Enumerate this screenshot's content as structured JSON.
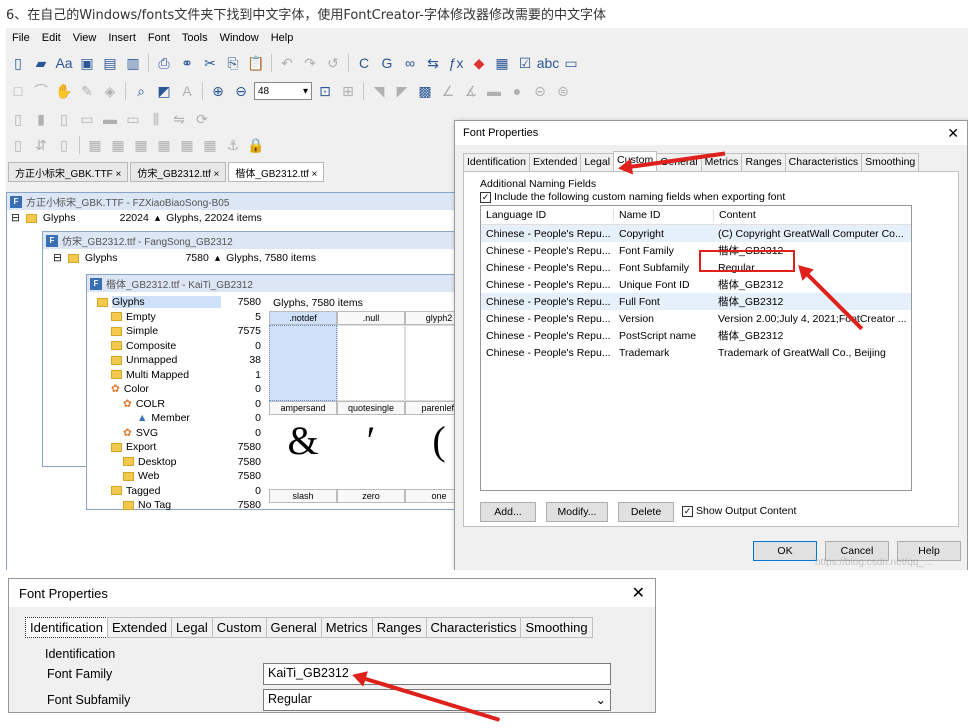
{
  "caption": "6、在自己的Windows/fonts文件夹下找到中文字体，使用FontCreator-字体修改器修改需要的中文字体",
  "menu": [
    "File",
    "Edit",
    "View",
    "Insert",
    "Font",
    "Tools",
    "Window",
    "Help"
  ],
  "zoom_value": "48",
  "doc_tabs": [
    "方正小标宋_GBK.TTF ×",
    "仿宋_GB2312.ttf ×",
    "楷体_GB2312.ttf ×"
  ],
  "win1": {
    "title": "方正小标宋_GBK.TTF - FZXiaoBiaoSong-B05",
    "node": "Glyphs",
    "count": "22024",
    "summary": "Glyphs, 22024 items"
  },
  "win2": {
    "title": "仿宋_GB2312.ttf - FangSong_GB2312",
    "node": "Glyphs",
    "count": "7580",
    "summary": "Glyphs, 7580 items"
  },
  "win3": {
    "title": "楷体_GB2312.ttf - KaiTi_GB2312",
    "summary": "Glyphs, 7580 items",
    "tree": [
      {
        "label": "Glyphs",
        "count": "7580"
      },
      {
        "label": "Empty",
        "count": "5"
      },
      {
        "label": "Simple",
        "count": "7575"
      },
      {
        "label": "Composite",
        "count": "0"
      },
      {
        "label": "Unmapped",
        "count": "38"
      },
      {
        "label": "Multi Mapped",
        "count": "1"
      },
      {
        "label": "Color",
        "count": "0"
      },
      {
        "label": "COLR",
        "count": "0"
      },
      {
        "label": "Member",
        "count": "0"
      },
      {
        "label": "SVG",
        "count": "0"
      },
      {
        "label": "Export",
        "count": "7580"
      },
      {
        "label": "Desktop",
        "count": "7580"
      },
      {
        "label": "Web",
        "count": "7580"
      },
      {
        "label": "Tagged",
        "count": "0"
      },
      {
        "label": "No Tag",
        "count": "7580"
      }
    ],
    "glyph_headers": [
      ".notdef",
      ".null",
      "glyph2"
    ],
    "glyph_row2": [
      "ampersand",
      "quotesingle",
      "parenleft"
    ],
    "glyph_chars": [
      "&",
      "′",
      "("
    ],
    "glyph_row3": [
      "slash",
      "zero",
      "one"
    ]
  },
  "dialog": {
    "title": "Font Properties",
    "tabs": [
      "Identification",
      "Extended",
      "Legal",
      "Custom",
      "General",
      "Metrics",
      "Ranges",
      "Characteristics",
      "Smoothing"
    ],
    "group": "Additional Naming Fields",
    "checkbox": "Include the following custom naming fields when exporting font",
    "columns": [
      "Language ID",
      "Name ID",
      "Content"
    ],
    "rows": [
      [
        "Chinese - People's Repu...",
        "Copyright",
        "(C) Copyright GreatWall Computer Co..."
      ],
      [
        "Chinese - People's Repu...",
        "Font Family",
        "楷体_GB2312"
      ],
      [
        "Chinese - People's Repu...",
        "Font Subfamily",
        "Regular"
      ],
      [
        "Chinese - People's Repu...",
        "Unique Font ID",
        "楷体_GB2312"
      ],
      [
        "Chinese - People's Repu...",
        "Full Font",
        "楷体_GB2312"
      ],
      [
        "Chinese - People's Repu...",
        "Version",
        "Version 2.00;July 4, 2021;FontCreator ..."
      ],
      [
        "Chinese - People's Repu...",
        "PostScript name",
        "楷体_GB2312"
      ],
      [
        "Chinese - People's Repu...",
        "Trademark",
        "Trademark of GreatWall Co., Beijing"
      ]
    ],
    "btn_add": "Add...",
    "btn_modify": "Modify...",
    "btn_delete": "Delete",
    "show_output": "Show Output Content",
    "btn_ok": "OK",
    "btn_cancel": "Cancel",
    "btn_help": "Help",
    "watermark": "https://blog.csdn.net/qq_..."
  },
  "dialog2": {
    "title": "Font Properties",
    "tabs": [
      "Identification",
      "Extended",
      "Legal",
      "Custom",
      "General",
      "Metrics",
      "Ranges",
      "Characteristics",
      "Smoothing"
    ],
    "group": "Identification",
    "family_label": "Font Family",
    "family_value": "KaiTi_GB2312",
    "subfamily_label": "Font Subfamily",
    "subfamily_value": "Regular"
  },
  "colors": {
    "accent": "#2b5797",
    "highlight": "#e0201a",
    "selection": "#cce0f8"
  }
}
